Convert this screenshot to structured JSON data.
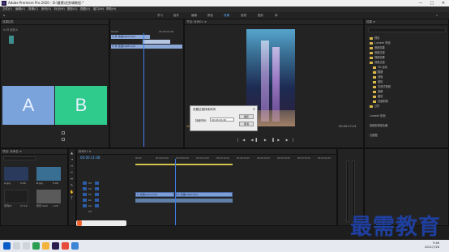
{
  "window": {
    "title": "Adobe Premiere Pro 2020 - D:\\最需\\优剪辑教程.*",
    "controls": [
      "—",
      "□",
      "✕"
    ]
  },
  "menu": [
    "文件(F)",
    "编辑(E)",
    "剪辑(C)",
    "序列(S)",
    "标记(M)",
    "图形(G)",
    "视图(V)",
    "窗口(W)",
    "帮助(H)"
  ],
  "workspaces": [
    "学习",
    "组件",
    "编辑",
    "颜色",
    "效果",
    "音频",
    "图形",
    "库"
  ],
  "workspace_active_index": 4,
  "source_panel": {
    "header": "效果控件",
    "line1": "fx 外 剪辑 A",
    "tiles": [
      "A",
      "B"
    ]
  },
  "effect_controls": {
    "header": "效果控件 ≡",
    "timecode_a": "00:00",
    "timecode_b": "00:00:01:00",
    "clip_labels": [
      "fx 外 基础ClipA.mp4",
      "fx 外 基础ClipB.mp4"
    ]
  },
  "program_monitor": {
    "header": "节目: 序列01 ≡",
    "timecode_left": "00:00:03:07",
    "timecode_right": "00:00:17:14",
    "fit_label": "适合"
  },
  "effects_panel": {
    "header": "效果 ≡",
    "items": [
      "预设",
      "Lumetri 预设",
      "音频效果",
      "音频过渡",
      "视频效果",
      "视频过渡",
      "3D 运动",
      "内滑",
      "划像",
      "擦除",
      "沉浸式视频",
      "溶解",
      "缩放",
      "页面剥落",
      "过时",
      "Lumetri 颜色",
      "音频剪辑混合器",
      "元数据"
    ]
  },
  "project_panel": {
    "header": "项目: 未命名 ≡",
    "search_placeholder": "",
    "items": [
      {
        "name": "A.jpg",
        "dur": "5:00"
      },
      {
        "name": "B.jpg",
        "dur": "5:00"
      },
      {
        "name": "序列01",
        "dur": "17:14"
      },
      {
        "name": "音乐.mp3",
        "dur": "1:20"
      }
    ]
  },
  "timeline": {
    "header": "序列01 ≡",
    "timecode": "00:00:11:08",
    "ruler": [
      "00:00",
      "00:00:04:29",
      "00:00:09:29",
      "00:00:14:29",
      "00:00:19:29",
      "00:00:24:29",
      "00:00:29:29",
      "00:00:34:29",
      "00:00:39:29",
      "00:00:44:29"
    ],
    "tracks": [
      "V3",
      "V2",
      "V1",
      "A1",
      "A2",
      "A3"
    ],
    "clips": [
      "fx 基础ClipA.mp4",
      "fx 基础ClipB.mp4"
    ]
  },
  "modal": {
    "title": "设置过渡持续时间",
    "close": "✕",
    "label": "持续时间:",
    "value": "00:00:01:00",
    "ok": "确定",
    "cancel": "取消"
  },
  "taskbar": {
    "time": "9:46",
    "date": "2021/7/28"
  },
  "watermark": "最需教育",
  "colors": {
    "accent": "#2d8ceb",
    "tile_a": "#7aa3db",
    "tile_b": "#2ecb8d",
    "clip": "#8aa7d8"
  }
}
